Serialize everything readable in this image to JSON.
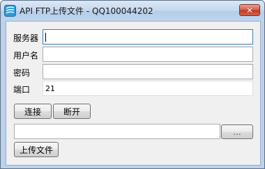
{
  "window": {
    "title": "API FTP上传文件 - QQ100044202",
    "close_label": "✕"
  },
  "form": {
    "server_label": "服务器",
    "server_value": "",
    "username_label": "用户名",
    "username_value": "",
    "password_label": "密码",
    "password_value": "",
    "port_label": "端口",
    "port_value": "21"
  },
  "buttons": {
    "connect": "连接",
    "disconnect": "断开",
    "browse": "...",
    "upload": "上传文件"
  },
  "file": {
    "path_value": ""
  }
}
